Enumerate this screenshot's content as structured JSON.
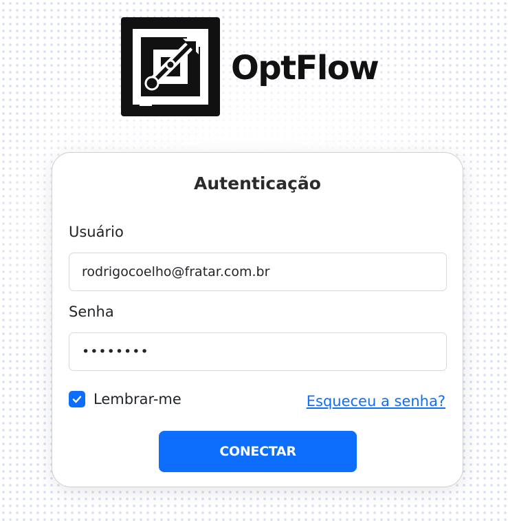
{
  "brand": {
    "name": "OptFlow",
    "logo_icon": "growth-arrow-icon"
  },
  "login": {
    "title": "Autenticação",
    "username_label": "Usuário",
    "username_value": "rodrigocoelho@fratar.com.br",
    "password_label": "Senha",
    "password_masked": "••••••••",
    "remember_label": "Lembrar-me",
    "remember_checked": true,
    "forgot_link": "Esqueceu a senha?",
    "submit_label": "CONECTAR"
  },
  "colors": {
    "primary": "#0d6efd",
    "logo": "#111111"
  }
}
